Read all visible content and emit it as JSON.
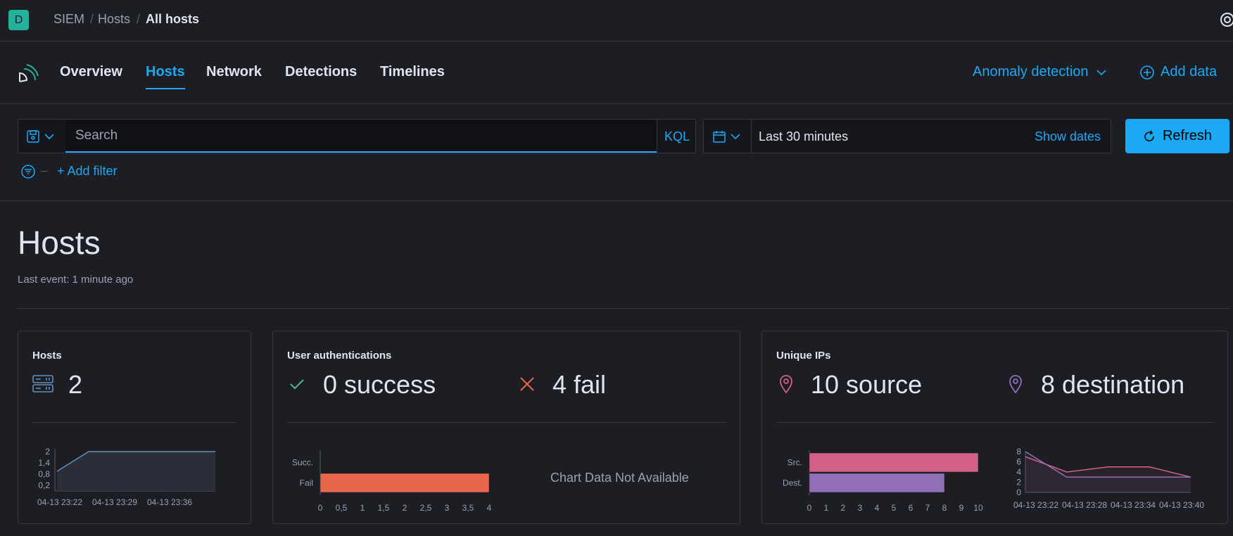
{
  "header": {
    "avatar_letter": "D",
    "breadcrumbs": [
      "SIEM",
      "Hosts",
      "All hosts"
    ]
  },
  "nav": {
    "tabs": [
      "Overview",
      "Hosts",
      "Network",
      "Detections",
      "Timelines"
    ],
    "active_tab": "Hosts",
    "anomaly_label": "Anomaly detection",
    "add_data_label": "Add data"
  },
  "query": {
    "search_placeholder": "Search",
    "language": "KQL",
    "time_range": "Last 30 minutes",
    "show_dates_label": "Show dates",
    "refresh_label": "Refresh",
    "add_filter_label": "+ Add filter"
  },
  "page": {
    "title": "Hosts",
    "last_event": "Last event: 1 minute ago"
  },
  "panels": {
    "hosts": {
      "title": "Hosts",
      "count": "2"
    },
    "auth": {
      "title": "User authentications",
      "success": "0 success",
      "fail": "4 fail",
      "no_data": "Chart Data Not Available"
    },
    "ips": {
      "title": "Unique IPs",
      "source": "10 source",
      "destination": "8 destination"
    }
  },
  "colors": {
    "accent": "#1ba9f5",
    "success": "#54b399",
    "fail": "#e7664c",
    "source": "#d36086",
    "destination": "#9170b8",
    "hosts_line": "#6092c0"
  },
  "chart_data": [
    {
      "type": "area",
      "title": "",
      "x_ticks": [
        "04-13 23:22",
        "04-13 23:29",
        "04-13 23:36"
      ],
      "y_ticks": [
        "2",
        "1,4",
        "0,8",
        "0,2"
      ],
      "series": [
        {
          "values": [
            1,
            2,
            2,
            2,
            2,
            2
          ]
        }
      ],
      "ylim": [
        0,
        2
      ]
    },
    {
      "type": "bar",
      "orientation": "horizontal",
      "categories": [
        "Succ.",
        "Fail"
      ],
      "values": [
        0,
        4
      ],
      "x_ticks": [
        "0",
        "0,5",
        "1",
        "1,5",
        "2",
        "2,5",
        "3",
        "3,5",
        "4"
      ],
      "xlim": [
        0,
        4
      ]
    },
    {
      "type": "bar",
      "orientation": "horizontal",
      "categories": [
        "Src.",
        "Dest."
      ],
      "values": [
        10,
        8
      ],
      "x_ticks": [
        "0",
        "1",
        "2",
        "3",
        "4",
        "5",
        "6",
        "7",
        "8",
        "9",
        "10"
      ],
      "xlim": [
        0,
        10
      ]
    },
    {
      "type": "line",
      "x_ticks": [
        "04-13 23:22",
        "04-13 23:28",
        "04-13 23:34",
        "04-13 23:40"
      ],
      "y_ticks": [
        "8",
        "6",
        "4",
        "2",
        "0"
      ],
      "series": [
        {
          "values": [
            7,
            4,
            5,
            5,
            3
          ]
        },
        {
          "values": [
            8,
            3,
            3,
            3,
            3
          ]
        }
      ],
      "ylim": [
        0,
        8
      ]
    }
  ]
}
